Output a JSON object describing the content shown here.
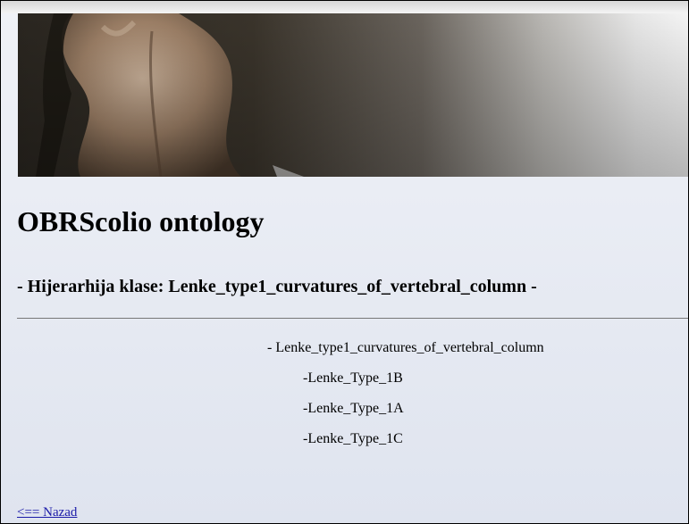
{
  "page": {
    "title": "OBRScolio ontology",
    "subtitle": "- Hijerarhija klase: Lenke_type1_curvatures_of_vertebral_column -"
  },
  "hierarchy": {
    "root": "- Lenke_type1_curvatures_of_vertebral_column",
    "children": [
      "-Lenke_Type_1B",
      "-Lenke_Type_1A",
      "-Lenke_Type_1C"
    ]
  },
  "navigation": {
    "back_link": "<== Nazad"
  },
  "colors": {
    "background": "#e5e9f3",
    "link": "#1a1aa8"
  }
}
